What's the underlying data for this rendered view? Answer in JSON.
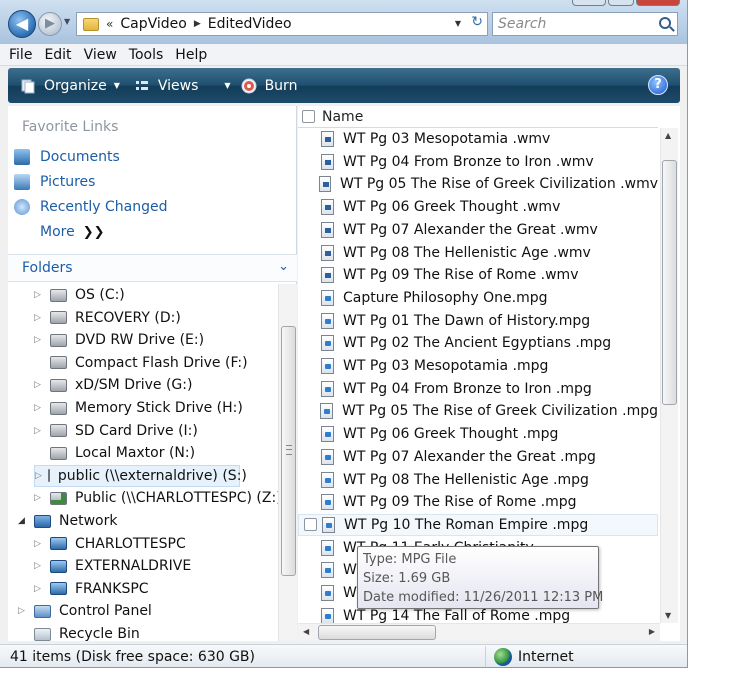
{
  "address": {
    "chevron": "«",
    "crumbs": [
      "CapVideo",
      "EditedVideo"
    ]
  },
  "search": {
    "placeholder": "Search"
  },
  "menu": [
    "File",
    "Edit",
    "View",
    "Tools",
    "Help"
  ],
  "toolbar": {
    "organize": "Organize",
    "views": "Views",
    "burn": "Burn",
    "help": "?"
  },
  "favorites": {
    "header": "Favorite Links",
    "links": [
      "Documents",
      "Pictures",
      "Recently Changed"
    ],
    "more": "More",
    "more_chevron": "❯❯"
  },
  "folders": {
    "header": "Folders",
    "tree": [
      {
        "label": "OS (C:)",
        "icon": "drive-icon",
        "expander": "closed"
      },
      {
        "label": "RECOVERY (D:)",
        "icon": "drive-icon",
        "expander": "closed"
      },
      {
        "label": "DVD RW Drive (E:)",
        "icon": "dvd-drive-icon",
        "expander": "closed"
      },
      {
        "label": "Compact Flash Drive (F:)",
        "icon": "card-drive-icon",
        "expander": "none"
      },
      {
        "label": "xD/SM Drive (G:)",
        "icon": "card-drive-icon",
        "expander": "closed"
      },
      {
        "label": "Memory Stick Drive (H:)",
        "icon": "card-drive-icon",
        "expander": "closed"
      },
      {
        "label": "SD Card Drive (I:)",
        "icon": "card-drive-icon",
        "expander": "closed"
      },
      {
        "label": "Local Maxtor (N:)",
        "icon": "drive-icon",
        "expander": "none"
      },
      {
        "label": "public (\\\\externaldrive) (S:)",
        "icon": "network-drive-icon",
        "expander": "closed",
        "selected": true
      },
      {
        "label": "Public (\\\\CHARLOTTESPC) (Z:)",
        "icon": "network-drive-icon",
        "expander": "closed"
      },
      {
        "label": "Network",
        "icon": "network-icon",
        "expander": "open"
      },
      {
        "label": "CHARLOTTESPC",
        "icon": "computer-icon",
        "expander": "closed"
      },
      {
        "label": "EXTERNALDRIVE",
        "icon": "computer-icon",
        "expander": "closed"
      },
      {
        "label": "FRANKSPC",
        "icon": "computer-icon",
        "expander": "closed"
      },
      {
        "label": "Control Panel",
        "icon": "control-panel-icon",
        "expander": "closed"
      },
      {
        "label": "Recycle Bin",
        "icon": "recycle-bin-icon",
        "expander": "none"
      }
    ]
  },
  "list": {
    "column_name": "Name",
    "files": [
      {
        "name": "WT Pg 03 Mesopotamia .wmv",
        "type": "wmv"
      },
      {
        "name": "WT Pg 04 From Bronze to Iron .wmv",
        "type": "wmv"
      },
      {
        "name": "WT Pg 05 The Rise of Greek Civilization .wmv",
        "type": "wmv"
      },
      {
        "name": "WT Pg 06 Greek Thought .wmv",
        "type": "wmv"
      },
      {
        "name": "WT Pg 07 Alexander the Great .wmv",
        "type": "wmv"
      },
      {
        "name": "WT Pg 08 The Hellenistic Age .wmv",
        "type": "wmv"
      },
      {
        "name": "WT Pg 09 The Rise of Rome .wmv",
        "type": "wmv"
      },
      {
        "name": "Capture Philosophy One.mpg",
        "type": "mpg"
      },
      {
        "name": "WT Pg 01 The Dawn of History.mpg",
        "type": "mpg"
      },
      {
        "name": "WT Pg 02 The Ancient Egyptians .mpg",
        "type": "mpg"
      },
      {
        "name": "WT Pg 03 Mesopotamia .mpg",
        "type": "mpg"
      },
      {
        "name": "WT Pg 04 From Bronze to Iron .mpg",
        "type": "mpg"
      },
      {
        "name": "WT Pg 05 The Rise of Greek Civilization .mpg",
        "type": "mpg"
      },
      {
        "name": "WT Pg 06 Greek Thought .mpg",
        "type": "mpg"
      },
      {
        "name": "WT Pg 07 Alexander the Great .mpg",
        "type": "mpg"
      },
      {
        "name": "WT Pg 08 The Hellenistic Age .mpg",
        "type": "mpg"
      },
      {
        "name": "WT Pg 09 The Rise of Rome .mpg",
        "type": "mpg"
      },
      {
        "name": "WT Pg 10 The Roman Empire .mpg",
        "type": "mpg",
        "hover": true
      },
      {
        "name": "WT Pg 11 Early Christianity",
        "type": "mpg"
      },
      {
        "name": "WT",
        "type": "mpg"
      },
      {
        "name": "WT",
        "type": "mpg"
      },
      {
        "name": "WT Pg 14 The Fall of Rome .mpg",
        "type": "mpg"
      }
    ]
  },
  "tooltip": {
    "type": "Type: MPG File",
    "size": "Size: 1.69 GB",
    "modified": "Date modified: 11/26/2011 12:13 PM"
  },
  "status": {
    "items": "41 items (Disk free space: 630 GB)",
    "zone": "Internet"
  }
}
